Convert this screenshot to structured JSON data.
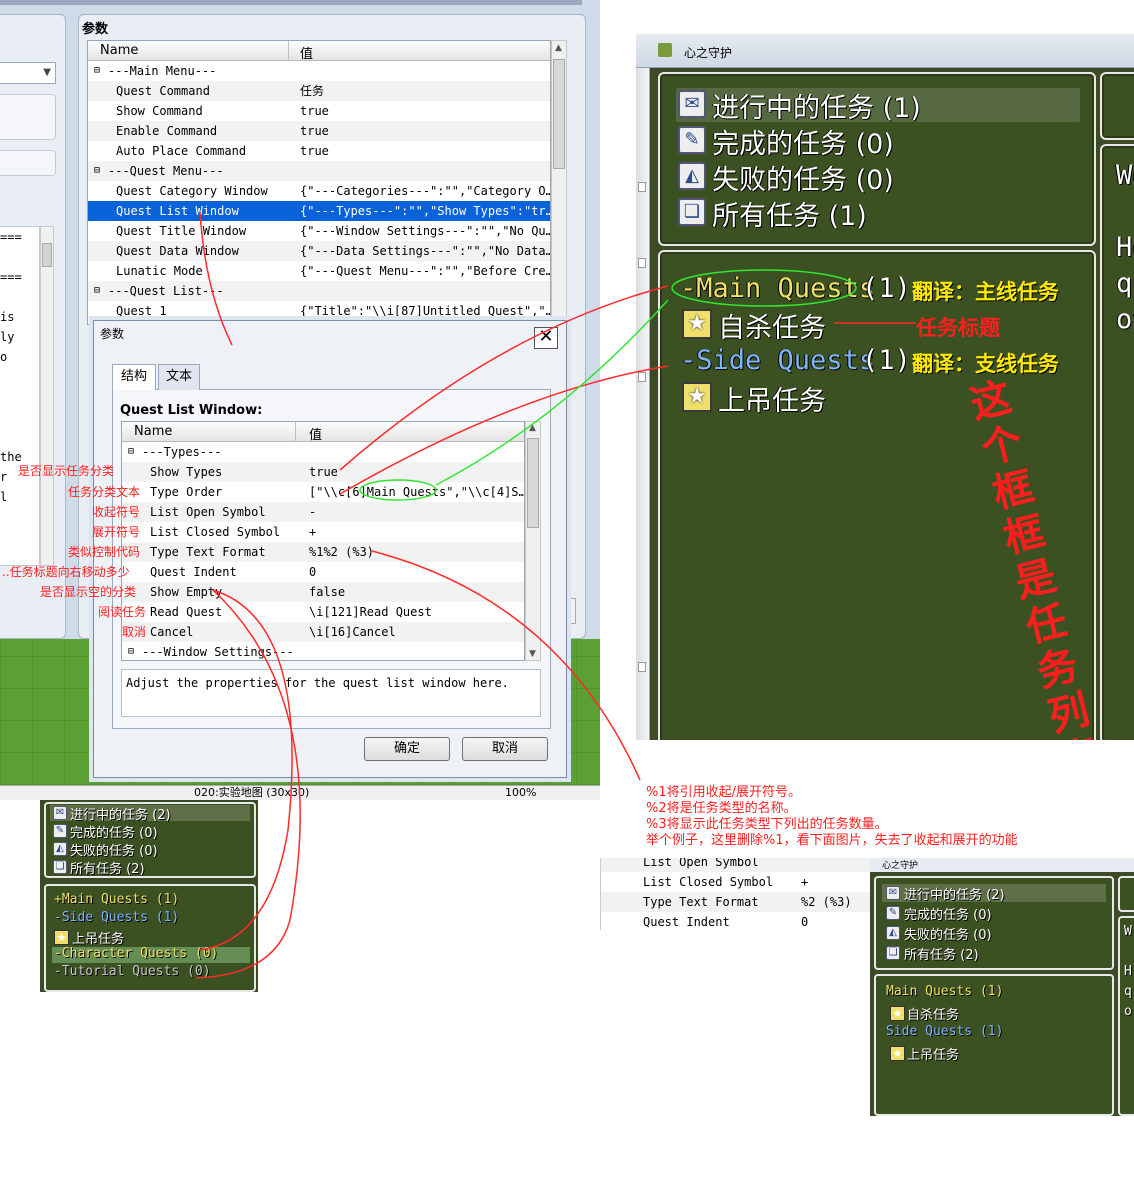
{
  "editor": {
    "param_group_title": "参数",
    "table_header_name": "Name",
    "table_header_value": "值",
    "rows": [
      {
        "glyph": "⊟",
        "name": "---Main Menu---",
        "value": "",
        "group": true
      },
      {
        "name": "Quest Command",
        "value": "任务"
      },
      {
        "name": "Show Command",
        "value": "true"
      },
      {
        "name": "Enable Command",
        "value": "true"
      },
      {
        "name": "Auto Place Command",
        "value": "true"
      },
      {
        "glyph": "⊟",
        "name": "---Quest Menu---",
        "value": "",
        "group": true
      },
      {
        "name": "Quest Category Window",
        "value": "{\"---Categories---\":\"\",\"Category O…"
      },
      {
        "name": "Quest List Window",
        "value": "{\"---Types---\":\"\",\"Show Types\":\"tr…",
        "selected": true
      },
      {
        "name": "Quest Title Window",
        "value": "{\"---Window Settings---\":\"\",\"No Qu…"
      },
      {
        "name": "Quest Data Window",
        "value": "{\"---Data Settings---\":\"\",\"No Data…"
      },
      {
        "name": "Lunatic Mode",
        "value": "{\"---Quest Menu---\":\"\",\"Before Cre…"
      },
      {
        "glyph": "⊟",
        "name": "---Quest List---",
        "value": "",
        "group": true
      },
      {
        "name": "Quest 1",
        "value": "{\"Title\":\"\\\\i[87]Untitled Quest\",\"…"
      }
    ],
    "left_text": [
      "===",
      "",
      "===",
      "",
      "is",
      "ly",
      "o",
      "",
      "",
      "",
      "",
      "the",
      "r",
      "l"
    ],
    "status_map": "020:实验地图 (30x30)",
    "status_zoom": "100%"
  },
  "dialog": {
    "title": "参数",
    "tab_structure": "结构",
    "tab_text": "文本",
    "caption": "Quest List Window:",
    "header_name": "Name",
    "header_value": "值",
    "rows": [
      {
        "glyph": "⊟",
        "name": "---Types---",
        "value": "",
        "group": true
      },
      {
        "name": "Show Types",
        "value": "true"
      },
      {
        "name": "Type Order",
        "value": "[\"\\\\c[6]Main Quests\",\"\\\\c[4]S…"
      },
      {
        "name": "List Open Symbol",
        "value": "-"
      },
      {
        "name": "List Closed Symbol",
        "value": "+"
      },
      {
        "name": "Type Text Format",
        "value": "%1%2 (%3)"
      },
      {
        "name": "Quest Indent",
        "value": "0"
      },
      {
        "name": "Show Empty",
        "value": "false"
      },
      {
        "name": "Read Quest",
        "value": "\\i[121]Read Quest"
      },
      {
        "name": "Cancel",
        "value": "\\i[16]Cancel"
      },
      {
        "glyph": "⊟",
        "name": "---Window Settings---",
        "value": "",
        "group": true
      }
    ],
    "description": "Adjust the properties for the quest list window here.",
    "ok_label": "确定",
    "cancel_label": "取消"
  },
  "annotations": {
    "show_types": "是否显示任务分类",
    "type_order": "任务分类文本",
    "open_symbol": "收起符号",
    "closed_symbol": "展开符号",
    "text_format": "类似控制代码",
    "indent": "..任务标题向右移动多少",
    "show_empty": "是否显示空的分类",
    "read_quest": "阅读任务",
    "cancel": "取消",
    "translate_main": "翻译：主线任务",
    "translate_side": "翻译：支线任务",
    "quest_title": "任务标题",
    "list_box": "这个框框是任务列表框",
    "note_lines": [
      "%1将引用收起/展开符号。",
      "%2将是任务类型的名称。",
      "%3将显示此任务类型下列出的任务数量。",
      "举个例子，这里删除%1，看下面图片，失去了收起和展开的功能"
    ]
  },
  "game": {
    "title": "心之守护",
    "categories": [
      {
        "icon": "paper-plane-icon",
        "label": "进行中的任务 (1)"
      },
      {
        "icon": "scroll-icon",
        "label": "完成的任务 (0)"
      },
      {
        "icon": "sail-icon",
        "label": "失败的任务 (0)"
      },
      {
        "icon": "book-icon",
        "label": "所有任务 (1)"
      }
    ],
    "main_quests_symbol": "-",
    "main_quests": "Main Quests",
    "main_count": "(1)",
    "quest_1": "自杀任务",
    "side_quests_symbol": "-",
    "side_quests": "Side Quests",
    "side_count": "(1)",
    "quest_2": "上吊任务",
    "right_text": [
      "We",
      "",
      "He",
      "qu",
      "ov"
    ],
    "colors": {
      "main_quests": "#f0e06a",
      "side_quests": "#7fb4ff",
      "annotation": "#ff1e1e",
      "translate": "#ffea00"
    }
  },
  "small_game_1": {
    "categories": [
      "进行中的任务 (2)",
      "完成的任务 (0)",
      "失败的任务 (0)",
      "所有任务 (2)"
    ],
    "list": [
      {
        "text": "+Main Quests (1)",
        "color": "#f0e06a"
      },
      {
        "text": "-Side Quests (1)",
        "color": "#7fb4ff"
      },
      {
        "text": "上吊任务",
        "star": true
      },
      {
        "text": "-Character Quests (0)",
        "color": "#f0e06a",
        "highlight": true
      },
      {
        "text": "-Tutorial Quests (0)",
        "color": "#c8c8c8"
      }
    ]
  },
  "small_table": [
    {
      "name": "List Open Symbol",
      "value": ""
    },
    {
      "name": "List Closed Symbol",
      "value": "+"
    },
    {
      "name": "Type Text Format",
      "value": "%2 (%3)"
    },
    {
      "name": "Quest Indent",
      "value": "0"
    }
  ],
  "small_game_2": {
    "title": "心之守护",
    "categories": [
      "进行中的任务 (2)",
      "完成的任务 (0)",
      "失败的任务 (0)",
      "所有任务 (2)"
    ],
    "list": [
      {
        "text": "Main Quests (1)",
        "color": "#f0e06a"
      },
      {
        "text": "自杀任务",
        "star": true
      },
      {
        "text": "Side Quests (1)",
        "color": "#7fb4ff"
      },
      {
        "text": "上吊任务",
        "star": true
      }
    ],
    "right_text": [
      "W",
      "",
      "H",
      "q",
      "o"
    ]
  }
}
